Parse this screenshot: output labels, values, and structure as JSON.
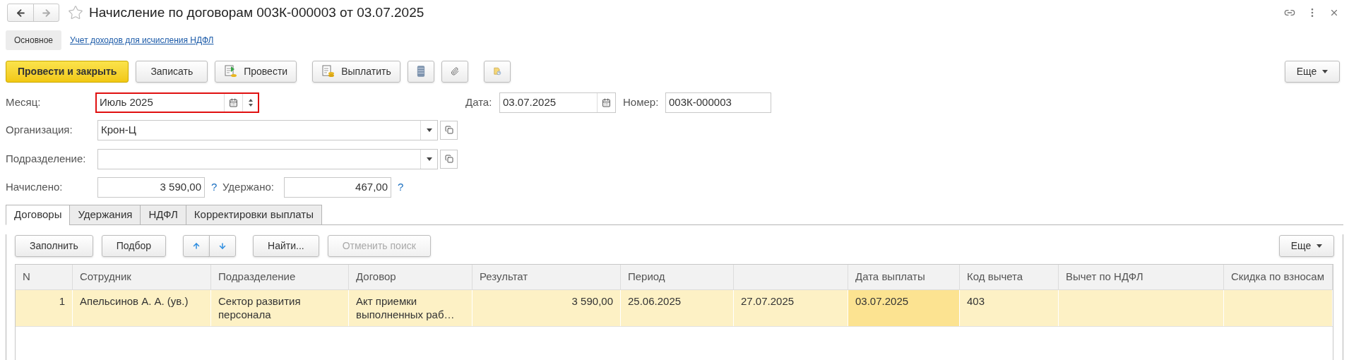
{
  "window": {
    "title": "Начисление по договорам 003К-000003 от 03.07.2025"
  },
  "nav_buttons": [
    {
      "kind": "back",
      "disabled": false
    },
    {
      "kind": "forward",
      "disabled": true
    }
  ],
  "section_tabs": [
    {
      "label": "Основное",
      "selected": true
    },
    {
      "label": "Учет доходов для исчисления НДФЛ",
      "selected": false
    }
  ],
  "toolbar": {
    "buttons": [
      {
        "kind": "primary",
        "label": "Провести и закрыть"
      },
      {
        "kind": "plain",
        "label": "Записать"
      },
      {
        "kind": "post",
        "label": "Провести"
      },
      {
        "kind": "pay",
        "label": "Выплатить"
      },
      {
        "kind": "registers"
      },
      {
        "kind": "attach"
      },
      {
        "kind": "report"
      }
    ],
    "more": "Еще"
  },
  "fields": {
    "month": {
      "label": "Месяц:",
      "value": "Июль 2025",
      "highlighted": true
    },
    "date": {
      "label": "Дата:",
      "value": "03.07.2025"
    },
    "number": {
      "label": "Номер:",
      "value": "003К-000003"
    },
    "organization": {
      "label": "Организация:",
      "value": "Крон-Ц"
    },
    "subdivision": {
      "label": "Подразделение:"
    },
    "accrued": {
      "label": "Начислено:",
      "value": "3 590,00",
      "help": "?"
    },
    "withheld": {
      "label": "Удержано:",
      "value": "467,00",
      "help": "?"
    }
  },
  "tabs": [
    {
      "label": "Договоры",
      "selected": true
    },
    {
      "label": "Удержания",
      "selected": false
    },
    {
      "label": "НДФЛ",
      "selected": false
    },
    {
      "label": "Корректировки выплаты",
      "selected": false
    }
  ],
  "table_toolbar": {
    "buttons": [
      {
        "kind": "text",
        "label": "Заполнить",
        "disabled": false
      },
      {
        "kind": "text",
        "label": "Подбор",
        "disabled": false
      },
      {
        "kind": "up"
      },
      {
        "kind": "down"
      },
      {
        "kind": "text",
        "label": "Найти...",
        "disabled": false
      },
      {
        "kind": "text",
        "label": "Отменить поиск",
        "disabled": true
      }
    ],
    "more": "Еще"
  },
  "table": {
    "columns": [
      "N",
      "Сотрудник",
      "Подразделение",
      "Договор",
      "Результат",
      "Период",
      "",
      "Дата выплаты",
      "Код вычета",
      "Вычет по НДФЛ",
      "Скидка по взносам"
    ],
    "rows": [
      {
        "selected": true,
        "cells": [
          {
            "text": "1",
            "current": false
          },
          {
            "text": "Апельсинов А. А. (ув.)",
            "current": false
          },
          {
            "text": "Сектор развития персонала",
            "current": false
          },
          {
            "text": "Акт приемки выполненных раб…",
            "current": false
          },
          {
            "text": "3 590,00",
            "current": false
          },
          {
            "text": "25.06.2025",
            "current": false
          },
          {
            "text": "27.07.2025",
            "current": false
          },
          {
            "text": "03.07.2025",
            "current": true
          },
          {
            "text": "403",
            "current": false
          },
          {
            "text": "",
            "current": false
          },
          {
            "text": "",
            "current": false
          }
        ]
      }
    ]
  }
}
